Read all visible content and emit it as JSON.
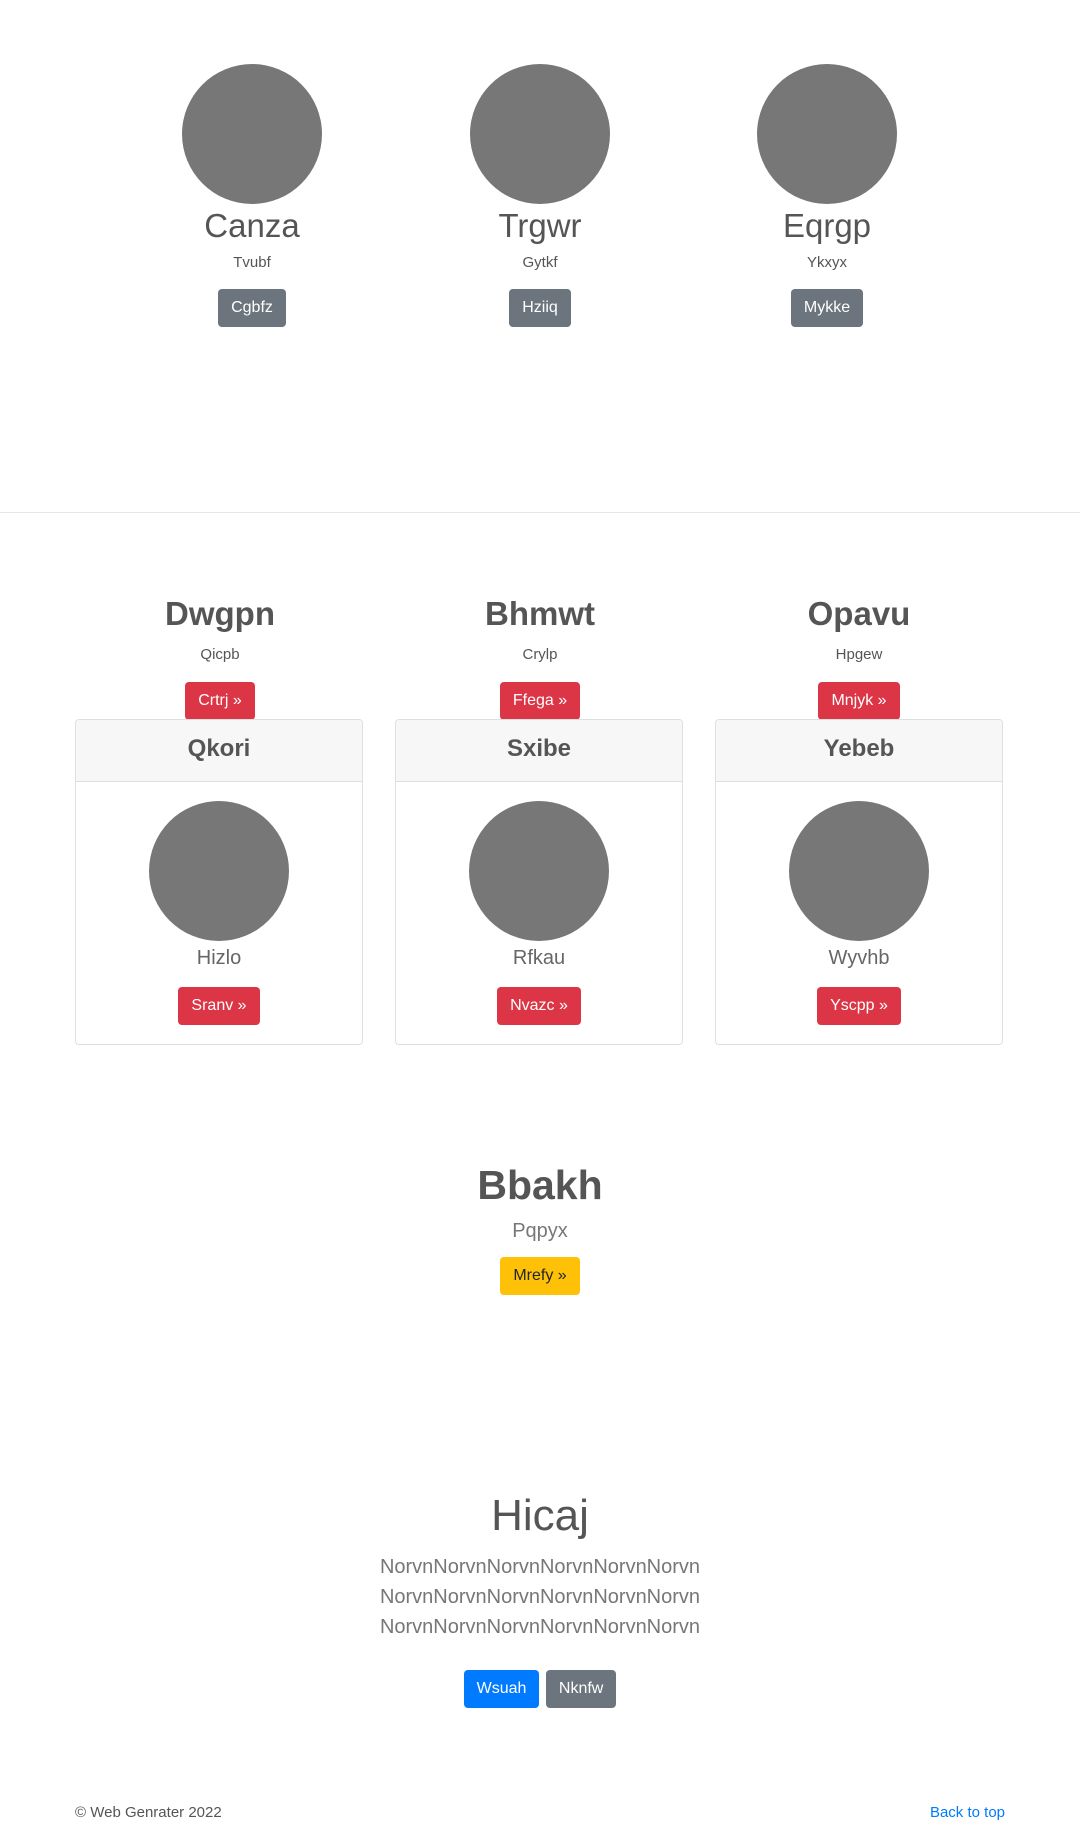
{
  "profiles": [
    {
      "name": "Canza",
      "subtitle": "Tvubf",
      "button": "Cgbfz"
    },
    {
      "name": "Trgwr",
      "subtitle": "Gytkf",
      "button": "Hziiq"
    },
    {
      "name": "Eqrgp",
      "subtitle": "Ykxyx",
      "button": "Mykke"
    }
  ],
  "features": [
    {
      "title": "Dwgpn",
      "subtitle": "Qicpb",
      "button": "Crtrj »"
    },
    {
      "title": "Bhmwt",
      "subtitle": "Crylp",
      "button": "Ffega »"
    },
    {
      "title": "Opavu",
      "subtitle": "Hpgew",
      "button": "Mnjyk »"
    }
  ],
  "cards": [
    {
      "header": "Qkori",
      "text": "Hizlo",
      "button": "Sranv »"
    },
    {
      "header": "Sxibe",
      "text": "Rfkau",
      "button": "Nvazc »"
    },
    {
      "header": "Yebeb",
      "text": "Wyvhb",
      "button": "Yscpp »"
    }
  ],
  "callout": {
    "title": "Bbakh",
    "subtitle": "Pqpyx",
    "button": "Mrefy »"
  },
  "hero": {
    "title": "Hicaj",
    "lead": "NorvnNorvnNorvnNorvnNorvnNorvnNorvnNorvnNorvnNorvnNorvnNorvnNorvnNorvnNorvnNorvnNorvnNorvn",
    "primary_button": "Wsuah",
    "secondary_button": "Nknfw"
  },
  "footer": {
    "copyright": "© Web Genrater 2022",
    "back_to_top": "Back to top"
  },
  "colors": {
    "avatar": "#777777",
    "secondary": "#6c757d",
    "danger": "#dc3545",
    "warning": "#ffc107",
    "primary": "#007bff"
  }
}
